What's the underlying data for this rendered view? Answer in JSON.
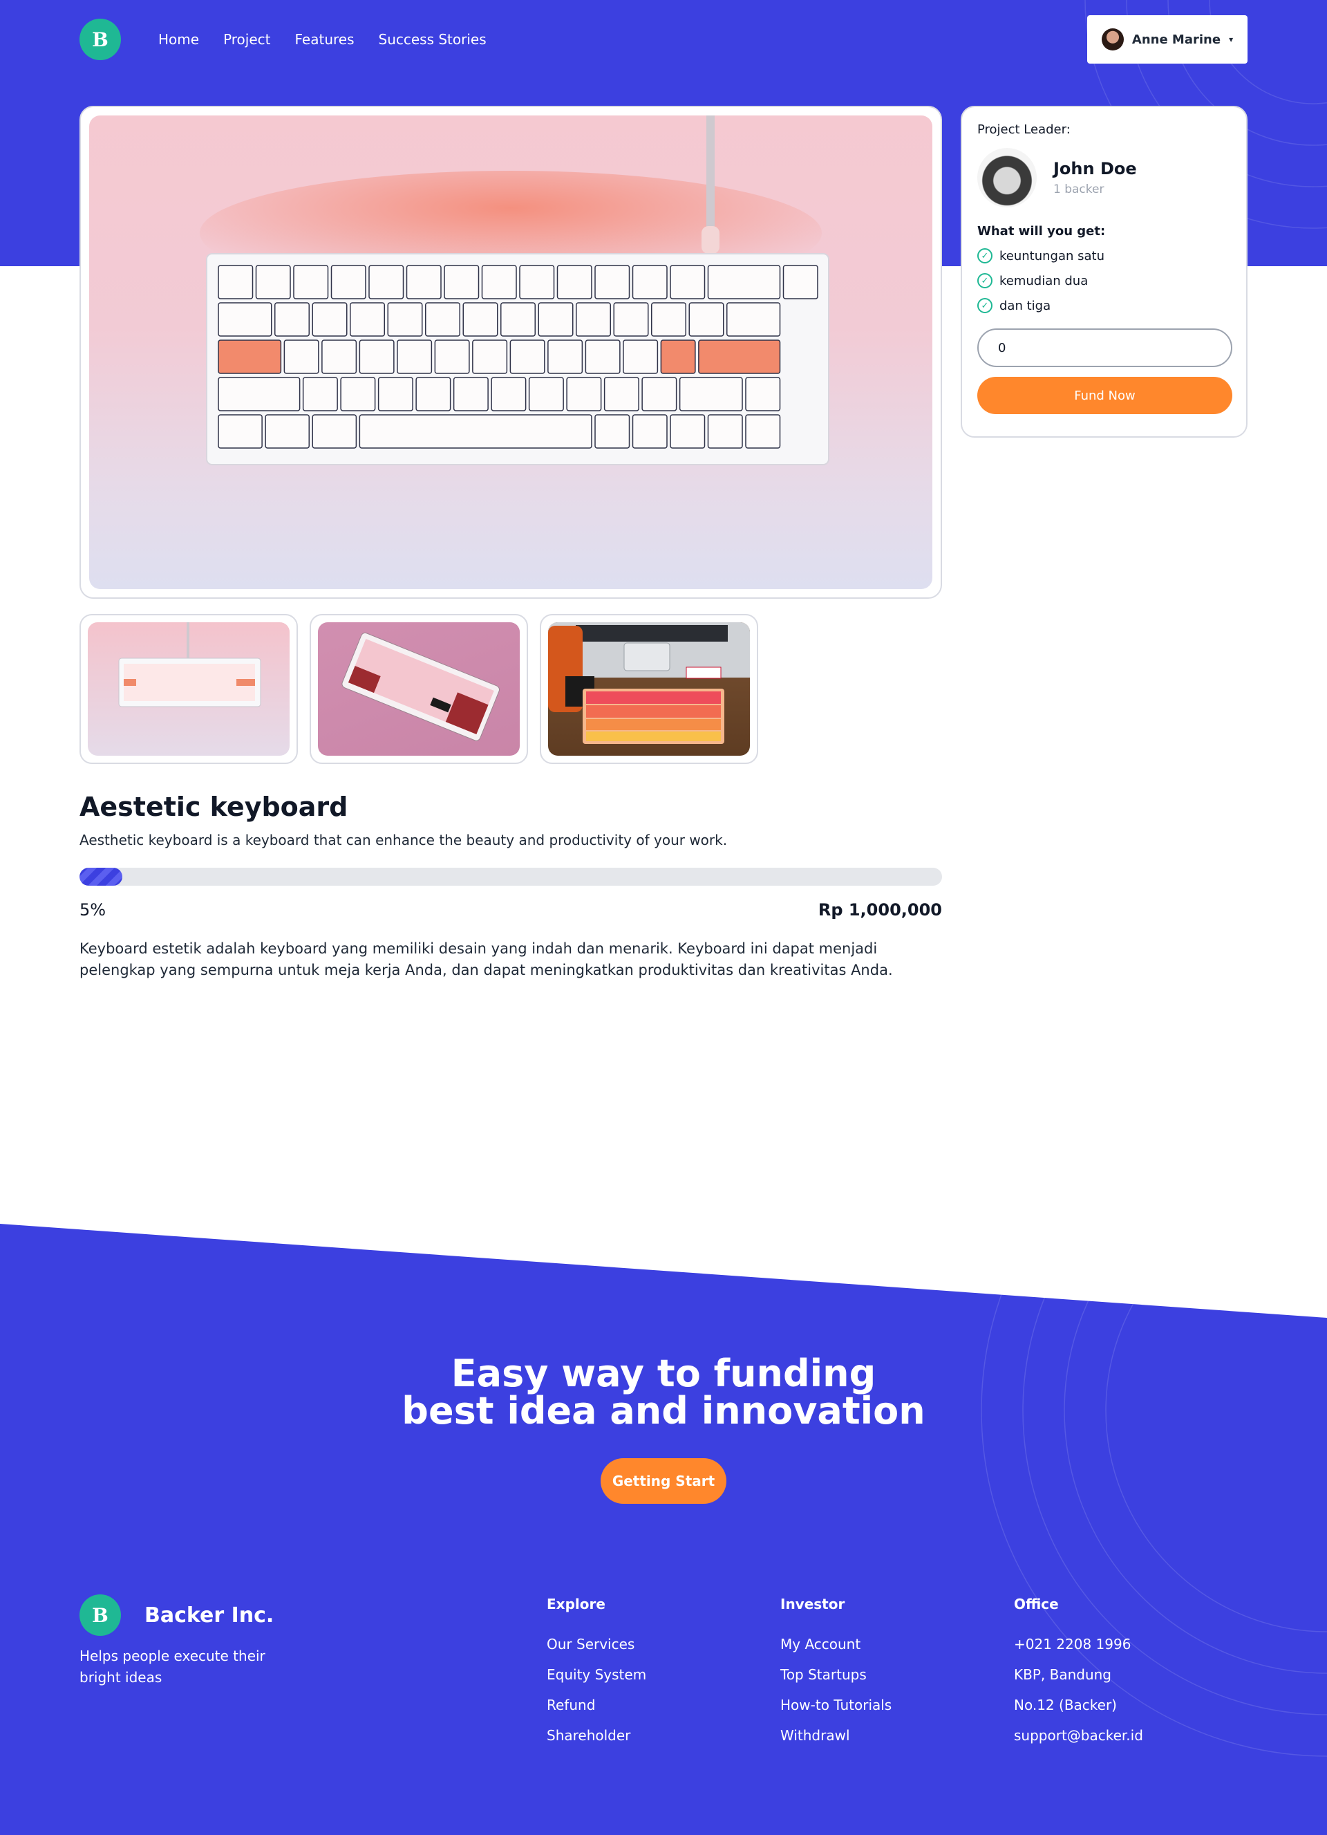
{
  "nav": {
    "logo_letter": "B",
    "links": [
      "Home",
      "Project",
      "Features",
      "Success Stories"
    ],
    "user_name": "Anne Marine"
  },
  "project": {
    "title": "Aestetic keyboard",
    "subtitle": "Aesthetic keyboard is a keyboard that can enhance the beauty and productivity of your work.",
    "progress_percent": 5,
    "progress_label": "5%",
    "amount": "Rp 1,000,000",
    "description": "Keyboard estetik adalah keyboard yang memiliki desain yang indah dan menarik. Keyboard ini dapat menjadi pelengkap yang sempurna untuk meja kerja Anda, dan dapat meningkatkan produktivitas dan kreativitas Anda."
  },
  "leader": {
    "label": "Project Leader:",
    "name": "John Doe",
    "backers": "1 backer",
    "perks_title": "What will you get:",
    "perks": [
      "keuntungan satu",
      "kemudian dua",
      "dan tiga"
    ],
    "fund_value": "0",
    "fund_button": "Fund Now"
  },
  "cta": {
    "line1": "Easy way to funding",
    "line2": "best idea and innovation",
    "button": "Getting Start"
  },
  "footer": {
    "brand": "Backer Inc.",
    "tagline": "Helps people execute their bright ideas",
    "columns": [
      {
        "title": "Explore",
        "items": [
          "Our Services",
          "Equity System",
          "Refund",
          "Shareholder"
        ]
      },
      {
        "title": "Investor",
        "items": [
          "My Account",
          "Top Startups",
          "How-to Tutorials",
          "Withdrawl"
        ]
      },
      {
        "title": "Office",
        "items": [
          "+021 2208 1996",
          "KBP, Bandung",
          "No.12 (Backer)",
          "support@backer.id"
        ]
      }
    ]
  },
  "colors": {
    "brand_blue": "#3c40e0",
    "accent_orange": "#ff872c",
    "logo_green": "#1fb894"
  }
}
